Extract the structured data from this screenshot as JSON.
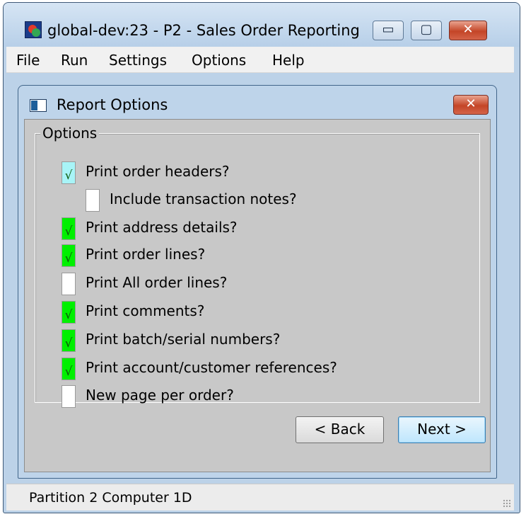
{
  "window": {
    "title": "global-dev:23 - P2 - Sales Order Reporting",
    "controls": {
      "minimize": "▭",
      "maximize": "▢",
      "close": "✕"
    }
  },
  "menu": [
    "File",
    "Run",
    "Settings",
    "Options",
    "Help"
  ],
  "dialog": {
    "title": "Report Options",
    "close": "✕",
    "group_label": "Options",
    "options": [
      {
        "label": "Print order headers?",
        "checked": true,
        "color": "#a8f4f7",
        "mark": "√"
      },
      {
        "label": "Include transaction notes?",
        "checked": false,
        "color": "#ffffff",
        "mark": ""
      },
      {
        "label": "Print address details?",
        "checked": true,
        "color": "#00f000",
        "mark": "√"
      },
      {
        "label": "Print order lines?",
        "checked": true,
        "color": "#00f000",
        "mark": "√"
      },
      {
        "label": "Print All order lines?",
        "checked": false,
        "color": "#ffffff",
        "mark": ""
      },
      {
        "label": "Print comments?",
        "checked": true,
        "color": "#00f000",
        "mark": "√"
      },
      {
        "label": "Print batch/serial numbers?",
        "checked": true,
        "color": "#00f000",
        "mark": "√"
      },
      {
        "label": "Print account/customer references?",
        "checked": true,
        "color": "#00f000",
        "mark": "√"
      },
      {
        "label": "New page per order?",
        "checked": false,
        "color": "#ffffff",
        "mark": ""
      }
    ],
    "back_label": "< Back",
    "next_label": "Next >"
  },
  "status": {
    "text": "Partition 2 Computer 1D"
  }
}
